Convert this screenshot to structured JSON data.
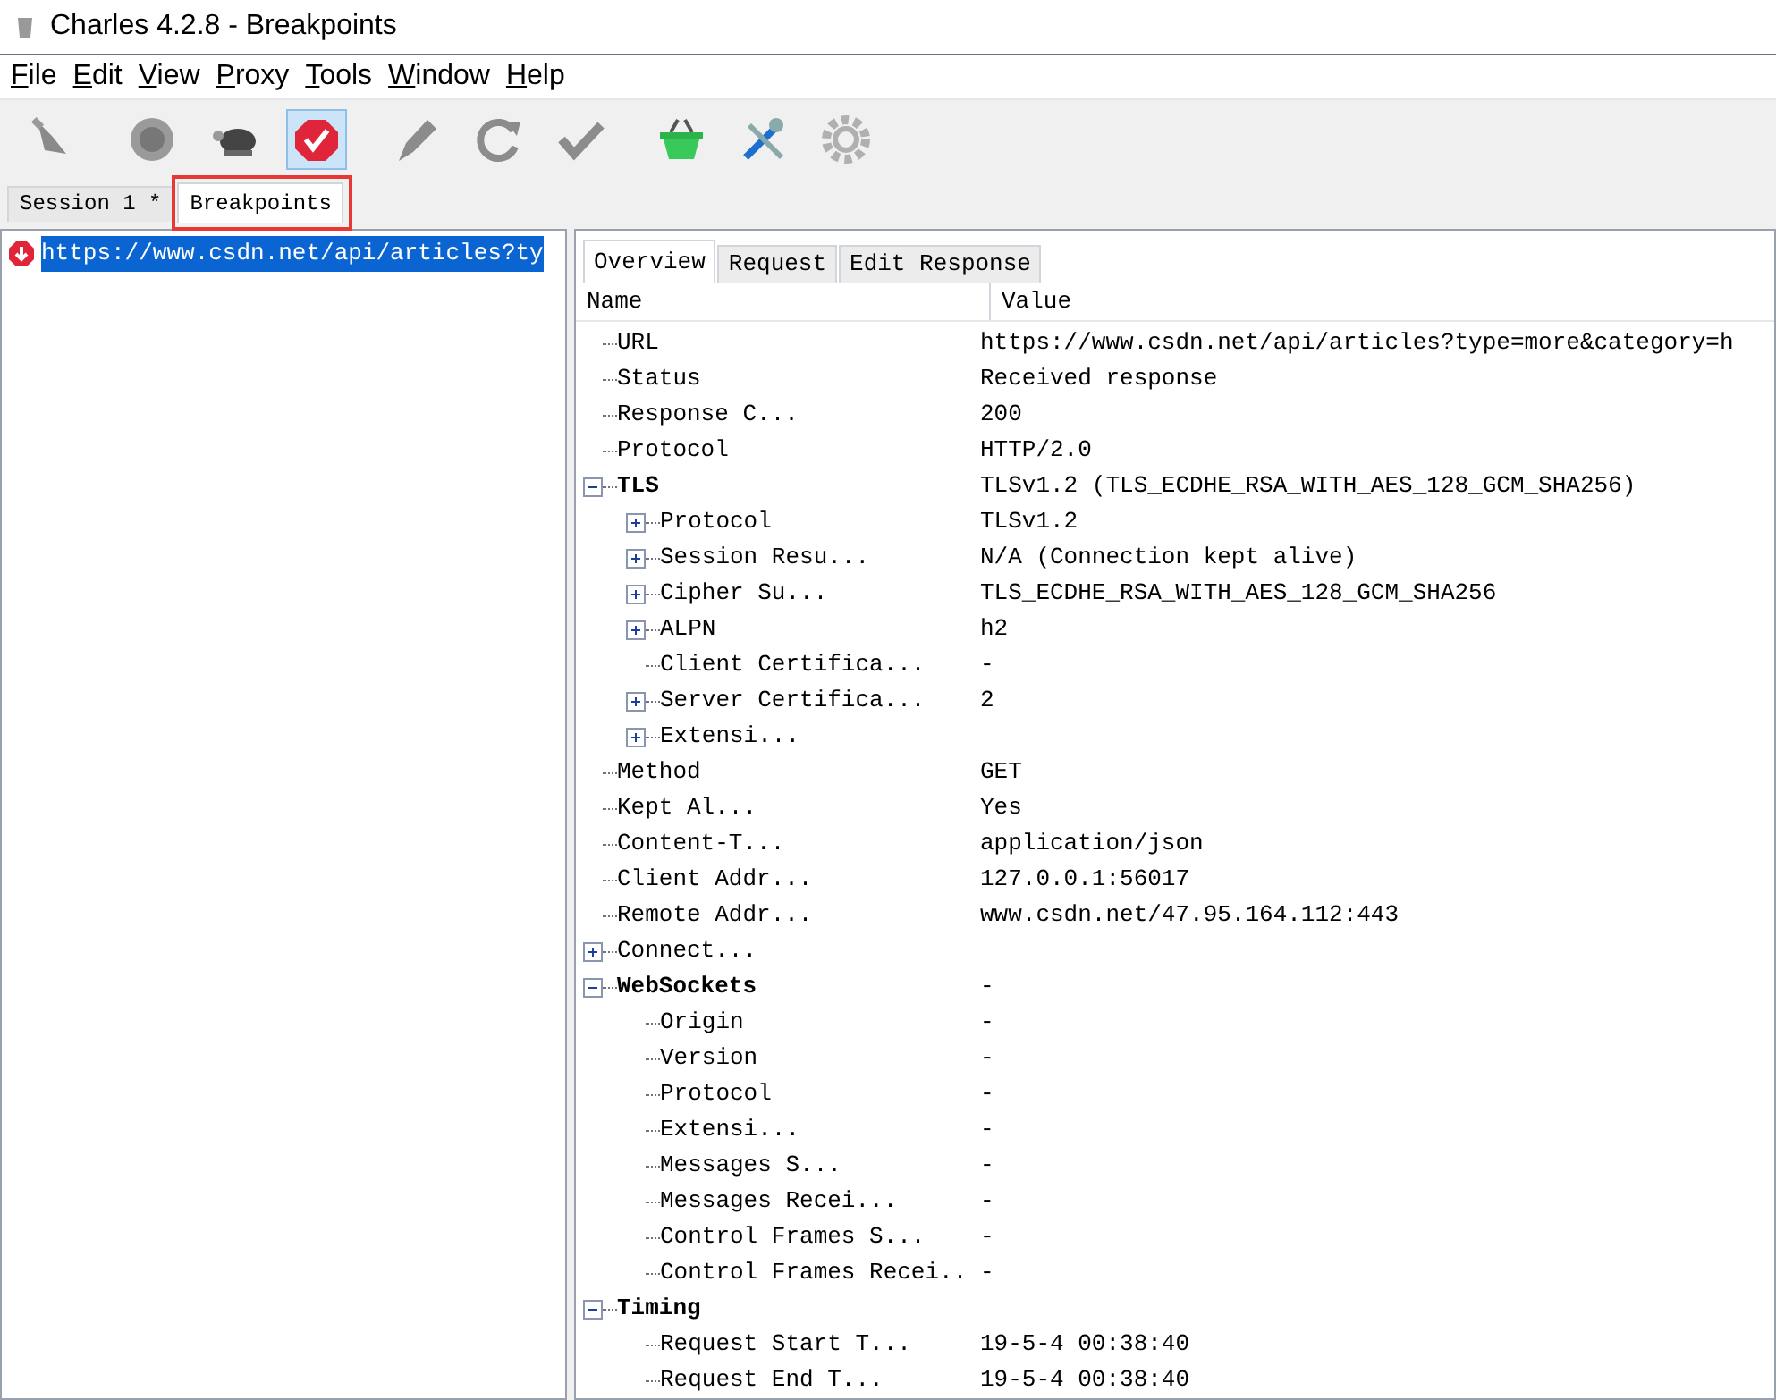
{
  "window": {
    "title": "Charles 4.2.8 - Breakpoints"
  },
  "menu": [
    "File",
    "Edit",
    "View",
    "Proxy",
    "Tools",
    "Window",
    "Help"
  ],
  "toolbar": [
    {
      "kind": "broom",
      "selected": false
    },
    {
      "kind": "record",
      "selected": false
    },
    {
      "kind": "turtle",
      "selected": false
    },
    {
      "kind": "breakpoint",
      "selected": true
    },
    {
      "kind": "pen",
      "selected": false
    },
    {
      "kind": "refresh",
      "selected": false
    },
    {
      "kind": "check",
      "selected": false
    },
    {
      "kind": "basket",
      "selected": false
    },
    {
      "kind": "tools",
      "selected": false
    },
    {
      "kind": "gear",
      "selected": false
    }
  ],
  "tabs": [
    {
      "label": "Session 1 *",
      "selected": false
    },
    {
      "label": "Breakpoints",
      "selected": true,
      "highlighted": true
    }
  ],
  "requests": [
    {
      "url": "https://www.csdn.net/api/articles?ty",
      "selected": true
    }
  ],
  "detail_tabs": [
    {
      "label": "Overview",
      "selected": true
    },
    {
      "label": "Request",
      "selected": false
    },
    {
      "label": "Edit Response",
      "selected": false
    }
  ],
  "overview": {
    "columns": [
      "Name",
      "Value"
    ],
    "rows": [
      {
        "name": "URL",
        "value": "https://www.csdn.net/api/articles?type=more&category=h"
      },
      {
        "name": "Status",
        "value": "Received response"
      },
      {
        "name": "Response C...",
        "value": "200"
      },
      {
        "name": "Protocol",
        "value": "HTTP/2.0"
      },
      {
        "name": "TLS",
        "value": "TLSv1.2 (TLS_ECDHE_RSA_WITH_AES_128_GCM_SHA256)",
        "bold": true,
        "expanded": true,
        "children": [
          {
            "name": "Protocol",
            "value": "TLSv1.2",
            "expanded": false
          },
          {
            "name": "Session Resu...",
            "value": "N/A (Connection kept alive)",
            "expanded": false
          },
          {
            "name": "Cipher Su...",
            "value": "TLS_ECDHE_RSA_WITH_AES_128_GCM_SHA256",
            "expanded": false
          },
          {
            "name": "ALPN",
            "value": "h2",
            "expanded": false
          },
          {
            "name": "Client Certifica...",
            "value": "-"
          },
          {
            "name": "Server Certifica...",
            "value": "2",
            "expanded": false
          },
          {
            "name": "Extensi...",
            "expanded": false
          }
        ]
      },
      {
        "name": "Method",
        "value": "GET"
      },
      {
        "name": "Kept Al...",
        "value": "Yes"
      },
      {
        "name": "Content-T...",
        "value": "application/json"
      },
      {
        "name": "Client Addr...",
        "value": "127.0.0.1:56017"
      },
      {
        "name": "Remote Addr...",
        "value": "www.csdn.net/47.95.164.112:443"
      },
      {
        "name": "Connect...",
        "expanded": false
      },
      {
        "name": "WebSockets",
        "value": "-",
        "bold": true,
        "expanded": true,
        "children": [
          {
            "name": "Origin",
            "value": "-"
          },
          {
            "name": "Version",
            "value": "-"
          },
          {
            "name": "Protocol",
            "value": "-"
          },
          {
            "name": "Extensi...",
            "value": "-"
          },
          {
            "name": "Messages S...",
            "value": "-"
          },
          {
            "name": "Messages Recei...",
            "value": "-"
          },
          {
            "name": "Control Frames S...",
            "value": "-"
          },
          {
            "name": "Control Frames Recei..",
            "value": "-"
          }
        ]
      },
      {
        "name": "Timing",
        "bold": true,
        "expanded": true,
        "children": [
          {
            "name": "Request Start T...",
            "value": "19-5-4 00:38:40"
          },
          {
            "name": "Request End T...",
            "value": "19-5-4 00:38:40"
          }
        ]
      }
    ]
  }
}
